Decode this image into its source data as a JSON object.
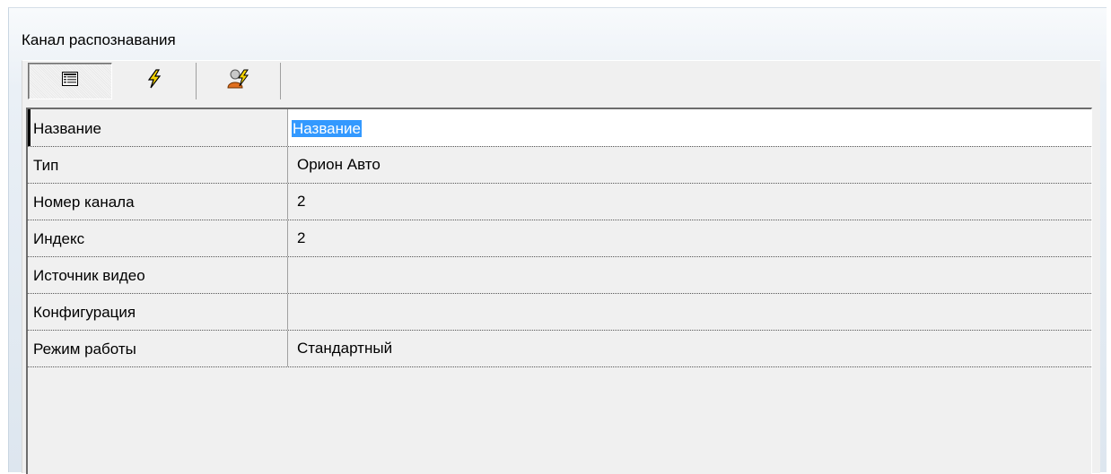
{
  "window": {
    "title": "Канал распознавания"
  },
  "toolbar": {
    "buttons": [
      {
        "icon": "properties-list-icon",
        "active": true
      },
      {
        "icon": "lightning-events-icon",
        "active": false
      },
      {
        "icon": "user-lightning-icon",
        "active": false
      }
    ]
  },
  "properties": [
    {
      "name": "Название",
      "value": "Название"
    },
    {
      "name": "Тип",
      "value": "Орион Авто"
    },
    {
      "name": "Номер канала",
      "value": "2"
    },
    {
      "name": "Индекс",
      "value": "2"
    },
    {
      "name": "Источник видео",
      "value": ""
    },
    {
      "name": "Конфигурация",
      "value": ""
    },
    {
      "name": "Режим работы",
      "value": "Стандартный"
    }
  ],
  "colors": {
    "selection": "#3399ff",
    "grid_background": "#f0f0f0"
  }
}
